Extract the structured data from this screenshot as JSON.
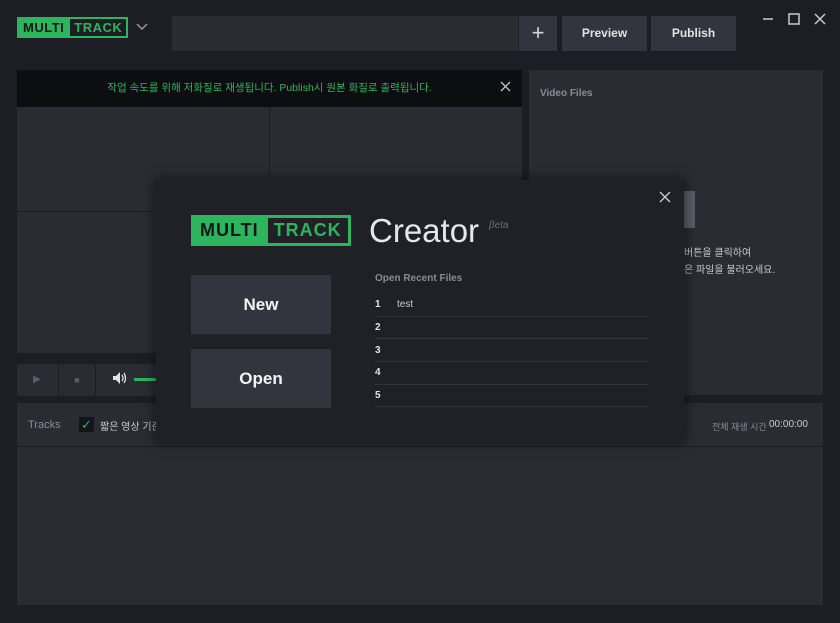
{
  "app": {
    "logo_part1": "MULTI",
    "logo_part2": "TRACK",
    "chevron_icon": "chevron-down-icon"
  },
  "toolbar": {
    "add_label": "+",
    "preview_label": "Preview",
    "publish_label": "Publish"
  },
  "window_controls": {
    "minimize": "–",
    "maximize": "□",
    "close": "✕"
  },
  "notice": {
    "text": "작업 속도를 위해 저화질로 재생됩니다. Publish시 원본 화질로 출력됩니다.",
    "close": "✕"
  },
  "video_panel": {
    "title": "Video Files",
    "hint_line1": "버튼을 클릭하여",
    "hint_line2": "은 파일을 불러오세요."
  },
  "player": {
    "play": "▶",
    "stop": "■",
    "volume": "🔊"
  },
  "tracks": {
    "label": "Tracks",
    "check": "✓",
    "checkbox_label": "짧은 영상 기준",
    "total_time_label": "전체 재생 시간",
    "total_time": "00:00:00"
  },
  "modal": {
    "close": "✕",
    "logo_part1": "MULTI",
    "logo_part2": "TRACK",
    "creator": "Creator",
    "beta": "βeta",
    "new_label": "New",
    "open_label": "Open",
    "recent_title": "Open Recent Files",
    "recent": [
      {
        "num": "1",
        "name": "test"
      },
      {
        "num": "2",
        "name": ""
      },
      {
        "num": "3",
        "name": ""
      },
      {
        "num": "4",
        "name": ""
      },
      {
        "num": "5",
        "name": ""
      }
    ]
  },
  "colors": {
    "accent": "#2db55d",
    "background": "#1d1e25",
    "panel": "#2a2b33",
    "button": "#33343d"
  }
}
